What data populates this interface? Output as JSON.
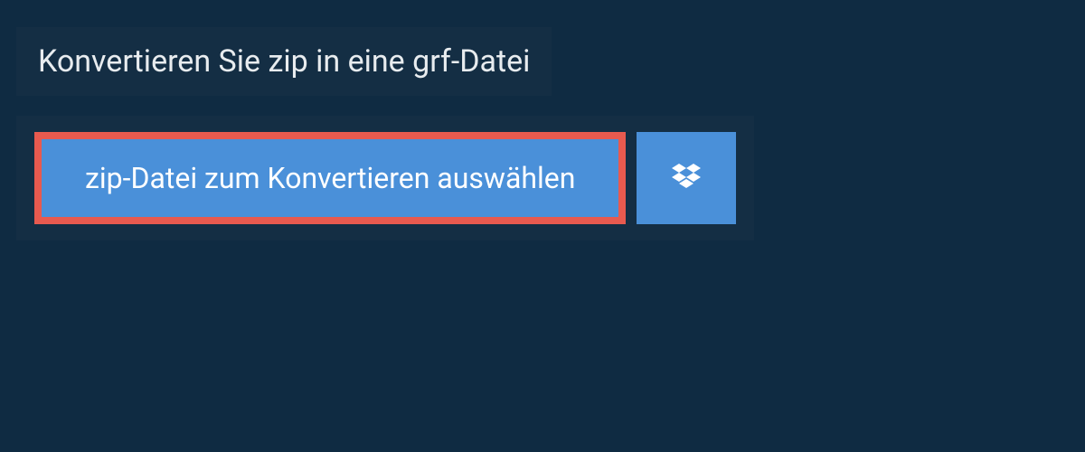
{
  "header": {
    "title": "Konvertieren Sie zip in eine grf-Datei"
  },
  "actions": {
    "select_file_label": "zip-Datei zum Konvertieren auswählen"
  },
  "colors": {
    "page_bg": "#0f2b42",
    "panel_bg": "#142e44",
    "button_bg": "#4a90d9",
    "highlight_border": "#e85a4f",
    "text_light": "#ffffff"
  }
}
